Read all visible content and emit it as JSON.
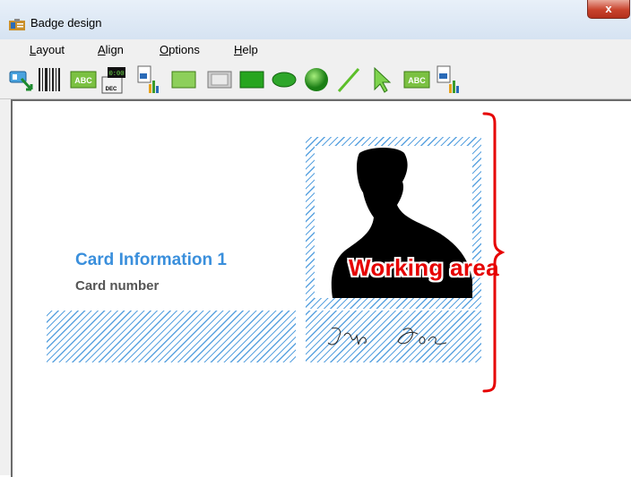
{
  "window": {
    "title": "Badge design",
    "close_label": "x"
  },
  "menu": {
    "items": [
      "Layout",
      "Align",
      "Options",
      "Help"
    ]
  },
  "toolbar": {
    "icons": [
      "export-icon",
      "barcode-icon",
      "text-abc-icon",
      "counter-icon",
      "image-jpg-icon",
      "frame-icon",
      "rectangle-icon",
      "ellipse-icon",
      "sphere-icon",
      "line-icon",
      "pointer-icon",
      "text-abc-icon-2",
      "image-ico-icon"
    ]
  },
  "card": {
    "title": "Card Information 1",
    "subtitle": "Card number",
    "working_area_label": "Working area",
    "signature_text": "John Doe"
  },
  "colors": {
    "accent": "#3a8fdc",
    "annotation": "#e60000",
    "hatch": "#5ba3e0"
  }
}
